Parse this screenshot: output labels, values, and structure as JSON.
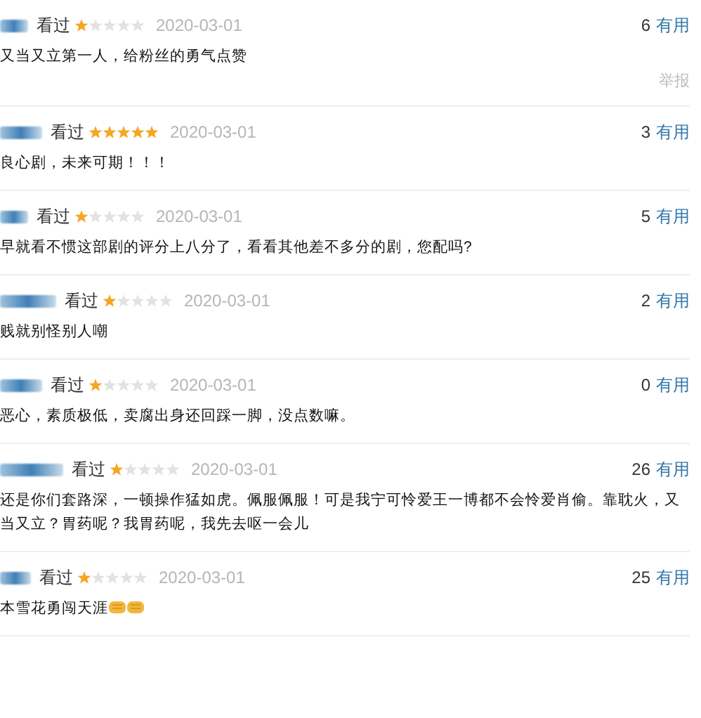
{
  "comments": [
    {
      "status": "看过",
      "stars": 1,
      "date": "2020-03-01",
      "votes": "6",
      "useful": "有用",
      "text": "又当又立第一人，给粉丝的勇气点赞",
      "report": "举报"
    },
    {
      "status": "看过",
      "stars": 5,
      "date": "2020-03-01",
      "votes": "3",
      "useful": "有用",
      "text": "良心剧，未来可期！！！"
    },
    {
      "status": "看过",
      "stars": 1,
      "date": "2020-03-01",
      "votes": "5",
      "useful": "有用",
      "text": "早就看不惯这部剧的评分上八分了，看看其他差不多分的剧，您配吗?"
    },
    {
      "status": "看过",
      "stars": 1,
      "date": "2020-03-01",
      "votes": "2",
      "useful": "有用",
      "text": "贱就别怪别人嘲"
    },
    {
      "status": "看过",
      "stars": 1,
      "date": "2020-03-01",
      "votes": "0",
      "useful": "有用",
      "text": "恶心，素质极低，卖腐出身还回踩一脚，没点数嘛。"
    },
    {
      "status": "看过",
      "stars": 1,
      "date": "2020-03-01",
      "votes": "26",
      "useful": "有用",
      "text": "还是你们套路深，一顿操作猛如虎。佩服佩服！可是我宁可怜爱王一博都不会怜爱肖偷。靠耽火，又当又立？胃药呢？我胃药呢，我先去呕一会儿"
    },
    {
      "status": "看过",
      "stars": 1,
      "date": "2020-03-01",
      "votes": "25",
      "useful": "有用",
      "text": "本雪花勇闯天涯",
      "reactions": [
        {
          "kind": "fist"
        },
        {
          "kind": "fist"
        }
      ]
    }
  ]
}
